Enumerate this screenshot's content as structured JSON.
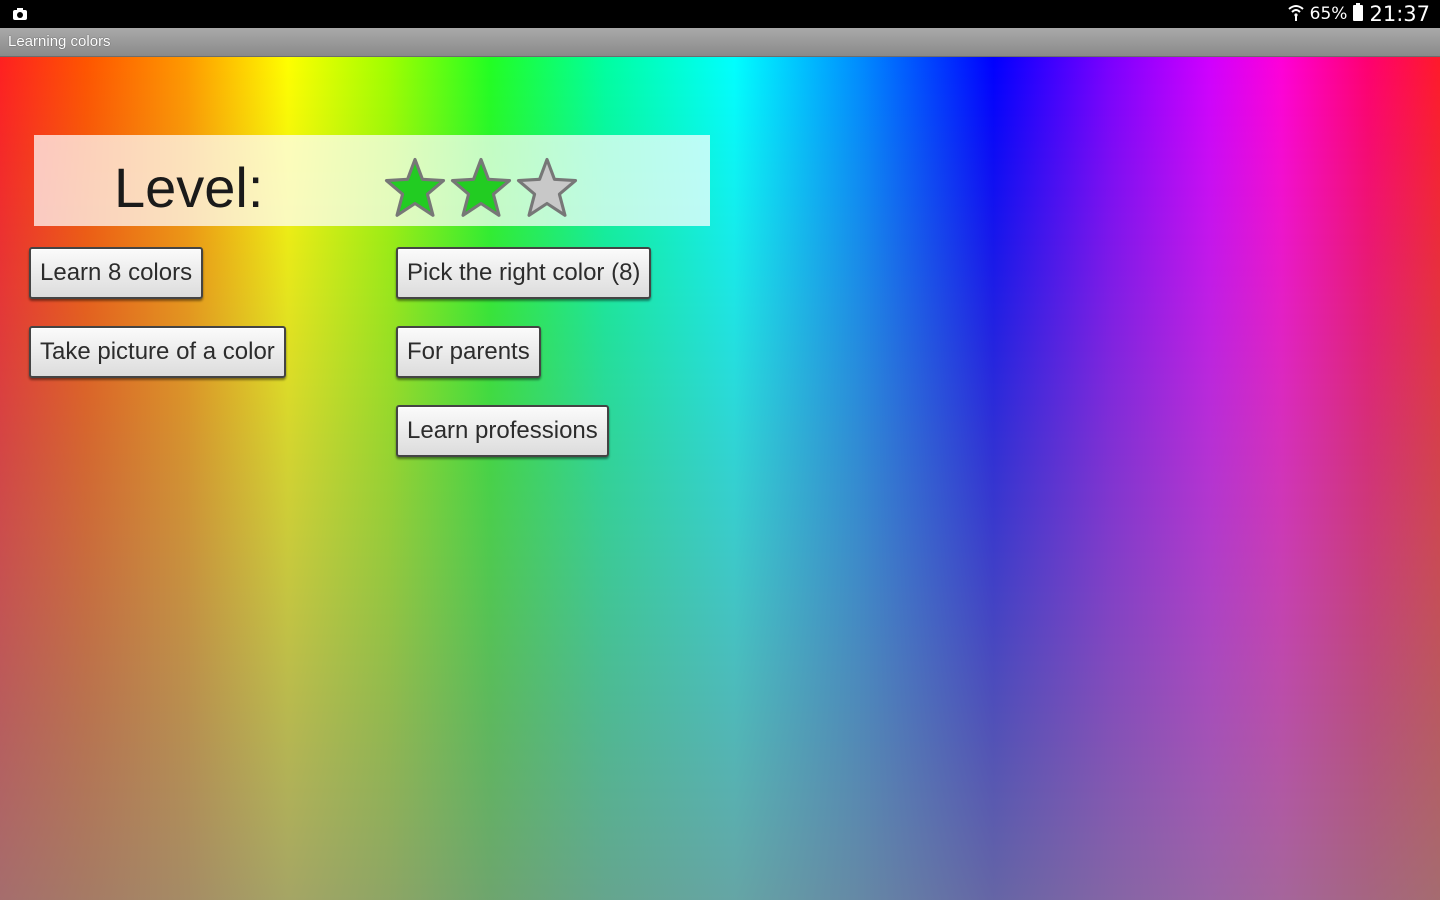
{
  "status_bar": {
    "notification_icon": "screenshot-icon",
    "wifi_icon": "wifi-icon",
    "battery_percent": "65%",
    "battery_icon": "battery-icon",
    "time": "21:37"
  },
  "app_bar": {
    "title": "Learning colors"
  },
  "level": {
    "label": "Level:",
    "stars_filled": 2,
    "stars_total": 3,
    "star_filled_color": "#22cc22",
    "star_empty_color": "#c8c8c8"
  },
  "buttons": {
    "learn_colors": "Learn 8 colors",
    "pick_color": "Pick the right color (8)",
    "take_picture": "Take picture of a color",
    "for_parents": "For parents",
    "learn_professions": "Learn professions"
  }
}
